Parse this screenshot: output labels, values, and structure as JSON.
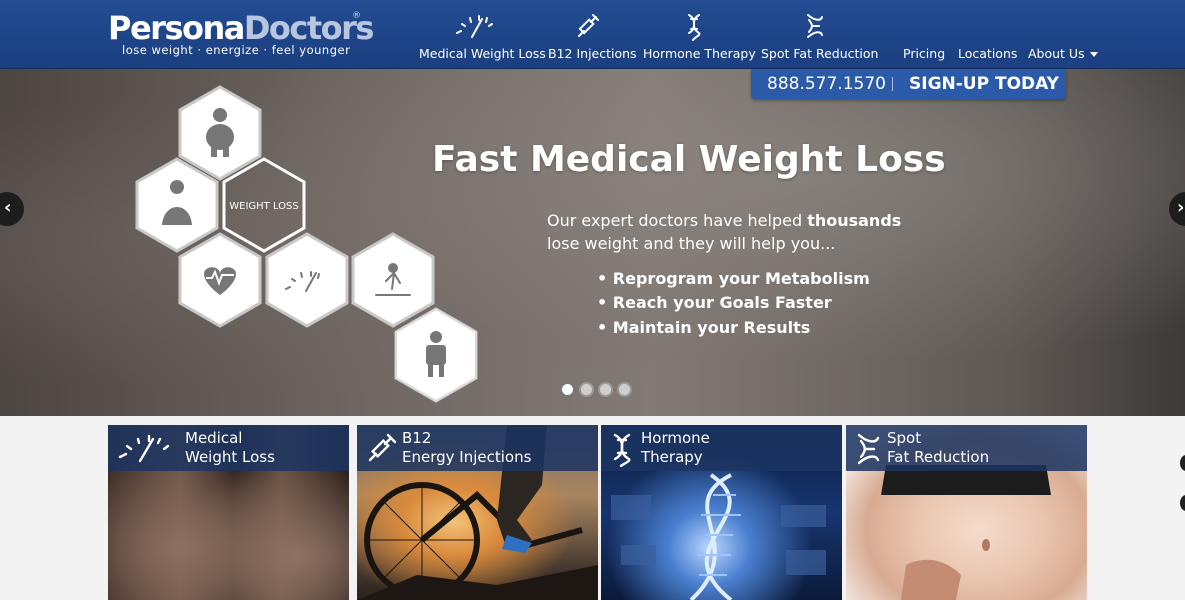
{
  "brand": {
    "name_part1": "Persona",
    "name_part2": "Doctors",
    "registered": "®",
    "tagline": "lose weight · energize · feel younger"
  },
  "nav": {
    "items": [
      {
        "label": "Medical Weight Loss",
        "icon": "gauge-icon"
      },
      {
        "label": "B12 Injections",
        "icon": "syringe-icon"
      },
      {
        "label": "Hormone Therapy",
        "icon": "dna-icon"
      },
      {
        "label": "Spot Fat Reduction",
        "icon": "spot-icon"
      }
    ],
    "links": [
      {
        "label": "Pricing"
      },
      {
        "label": "Locations"
      },
      {
        "label": "About Us",
        "icon": "caret-down-icon"
      }
    ]
  },
  "cta": {
    "phone": "888.577.1570",
    "signup": "SIGN-UP TODAY"
  },
  "hero": {
    "title": "Fast Medical Weight Loss",
    "sub_line1_pre": "Our expert doctors have helped ",
    "sub_line1_bold": "thousands",
    "sub_line2": "lose weight and they will help you...",
    "bullets": [
      "• Reprogram your Metabolism",
      "• Reach your Goals Faster",
      "• Maintain your Results"
    ],
    "hex_label": "WEIGHT LOSS",
    "slides": 4,
    "active_slide": 1,
    "prev_glyph": "‹",
    "next_glyph": "›"
  },
  "cards": [
    {
      "line1": "Medical",
      "line2": "Weight Loss",
      "icon": "gauge-icon"
    },
    {
      "line1": "B12",
      "line2": "Energy Injections",
      "icon": "syringe-icon"
    },
    {
      "line1": "Hormone",
      "line2": "Therapy",
      "icon": "dna-icon"
    },
    {
      "line1": "Spot",
      "line2": "Fat Reduction",
      "icon": "spot-icon"
    }
  ],
  "colors": {
    "header": "#1f4589",
    "cta": "#2b5aa8",
    "card_bar": "#1c3462"
  }
}
